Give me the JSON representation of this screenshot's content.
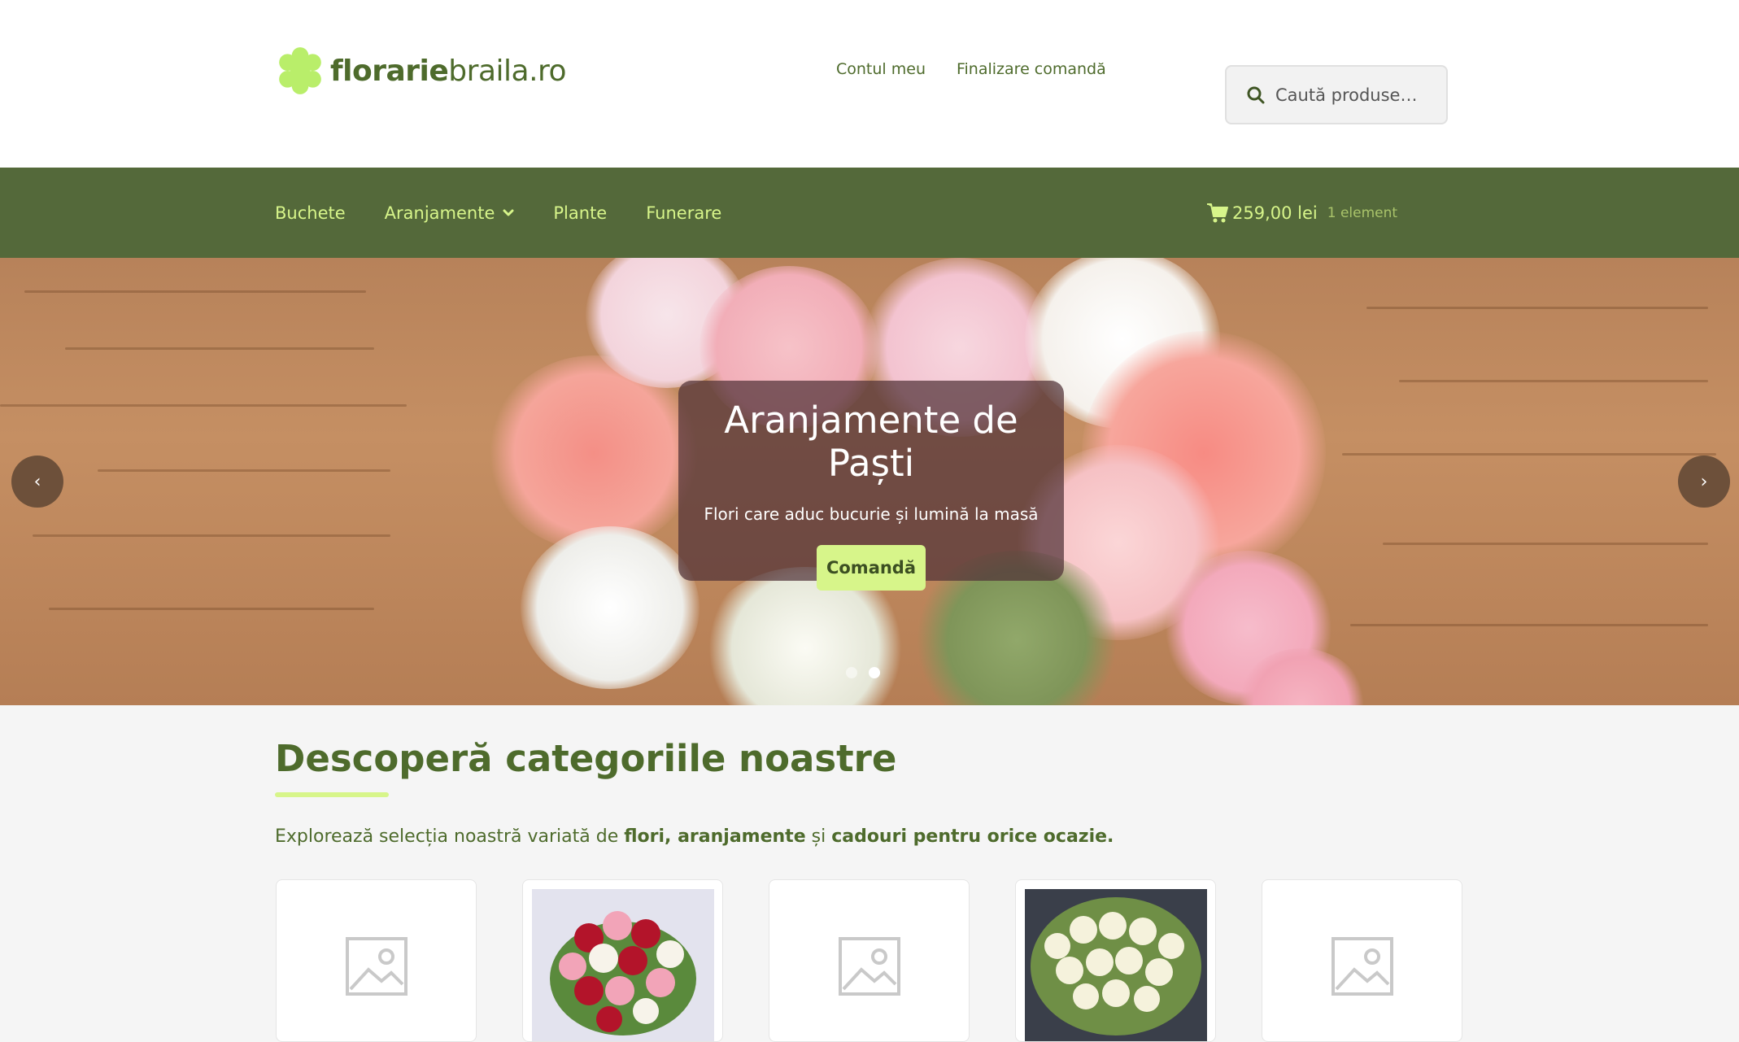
{
  "brand": {
    "logo_bold": "florarie",
    "logo_regular": "braila.ro",
    "accent": "#d7f58a",
    "primary": "#54693a"
  },
  "secondary_nav": [
    "Contul meu",
    "Finalizare comandă"
  ],
  "search": {
    "placeholder": "Caută produse…",
    "icon": "search-icon"
  },
  "primary_nav": {
    "items": [
      "Buchete",
      "Aranjamente",
      "Plante",
      "Funerare"
    ],
    "dropdown_icon": "chevron-down-icon"
  },
  "cart": {
    "amount": "259,00 lei",
    "count": "1 element",
    "icon": "cart-icon"
  },
  "hero": {
    "title": "Aranjamente de Paști",
    "subtitle": "Flori care aduc bucurie și lumină la masă",
    "button": "Comandă",
    "prev": "‹",
    "next": "›",
    "slides": 2,
    "active_slide": 2
  },
  "categories": {
    "title": "Descoperă categoriile noastre",
    "intro_pre": "Explorează selecția noastră variată de ",
    "intro_b1": "flori, aranjamente",
    "intro_mid": " și ",
    "intro_b2": "cadouri pentru orice ocazie."
  }
}
